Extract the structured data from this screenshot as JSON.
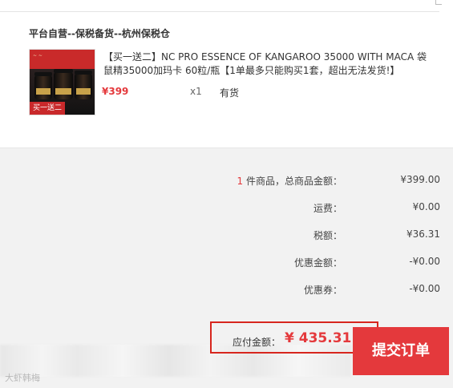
{
  "order": {
    "warehouse_title": "平台自营--保税备货--杭州保税仓",
    "product": {
      "promo_tag": "买一送二",
      "title": "【买一送二】NC PRO ESSENCE OF KANGAROO 35000 WITH MACA 袋鼠精35000加玛卡 60粒/瓶【1单最多只能购买1套，超出无法发货!】",
      "price": "¥399",
      "quantity": "x1",
      "stock_status": "有货"
    }
  },
  "summary": {
    "items_count": "1",
    "items_label": " 件商品，总商品金额：",
    "items_total": "¥399.00",
    "shipping_label": "运费：",
    "shipping_value": "¥0.00",
    "tax_label": "税额：",
    "tax_value": "¥36.31",
    "discount_label": "优惠金额：",
    "discount_value": "-¥0.00",
    "coupon_label": "优惠券：",
    "coupon_value": "-¥0.00"
  },
  "checkout": {
    "payable_label": "应付金额：",
    "payable_amount": "¥ 435.31",
    "submit_label": "提交订单"
  },
  "watermark": "大虾韩梅",
  "colors": {
    "accent": "#e4393c",
    "highlight_border": "#d7261e",
    "background": "#f2f2f2"
  }
}
